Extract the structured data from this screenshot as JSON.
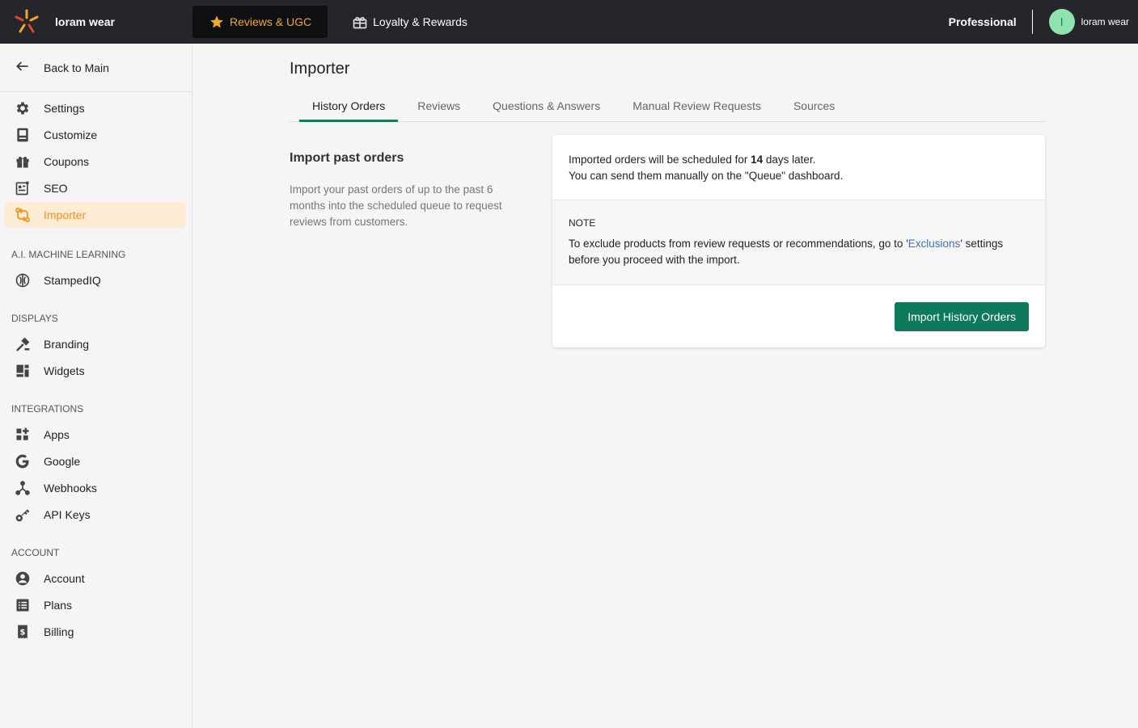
{
  "topbar": {
    "brand_name": "loram wear",
    "nav": [
      {
        "label": "Reviews & UGC",
        "icon": "star-icon",
        "active": true
      },
      {
        "label": "Loyalty & Rewards",
        "icon": "gift-icon",
        "active": false
      }
    ],
    "plan": "Professional",
    "avatar_initial": "l",
    "user_name": "loram wear"
  },
  "sidebar": {
    "back_label": "Back to Main",
    "items": [
      {
        "label": "Settings",
        "icon": "gear-icon"
      },
      {
        "label": "Customize",
        "icon": "customize-icon"
      },
      {
        "label": "Coupons",
        "icon": "gift-icon"
      },
      {
        "label": "SEO",
        "icon": "seo-icon"
      },
      {
        "label": "Importer",
        "icon": "importer-icon",
        "active": true
      }
    ],
    "sections": {
      "ai": {
        "label": "A.I. MACHINE LEARNING",
        "items": [
          {
            "label": "StampedIQ",
            "icon": "brain-icon"
          }
        ]
      },
      "displays": {
        "label": "DISPLAYS",
        "items": [
          {
            "label": "Branding",
            "icon": "hammer-icon"
          },
          {
            "label": "Widgets",
            "icon": "widgets-icon"
          }
        ]
      },
      "integrations": {
        "label": "INTEGRATIONS",
        "items": [
          {
            "label": "Apps",
            "icon": "apps-icon"
          },
          {
            "label": "Google",
            "icon": "google-icon"
          },
          {
            "label": "Webhooks",
            "icon": "webhooks-icon"
          },
          {
            "label": "API Keys",
            "icon": "key-icon"
          }
        ]
      },
      "account": {
        "label": "ACCOUNT",
        "items": [
          {
            "label": "Account",
            "icon": "user-icon"
          },
          {
            "label": "Plans",
            "icon": "list-icon"
          },
          {
            "label": "Billing",
            "icon": "billing-icon"
          }
        ]
      }
    }
  },
  "main": {
    "title": "Importer",
    "tabs": [
      "History Orders",
      "Reviews",
      "Questions & Answers",
      "Manual Review Requests",
      "Sources"
    ],
    "active_tab": 0,
    "section_title": "Import past orders",
    "section_desc": "Import your past orders of up to the past 6 months into the scheduled queue to request reviews from customers.",
    "card": {
      "line1_prefix": "Imported orders will be scheduled for ",
      "line1_days": "14",
      "line1_suffix": " days later.",
      "line2": "You can send them manually on the \"Queue\" dashboard.",
      "note_title": "NOTE",
      "note_prefix": "To exclude products from review requests or recommendations, go to '",
      "note_link": "Exclusions",
      "note_suffix": "' settings before you proceed with the import.",
      "button": "Import History Orders"
    }
  },
  "colors": {
    "topbar_bg": "#24262b",
    "accent_orange": "#f0901f",
    "primary_green": "#0e7a5b",
    "link_blue": "#3b6fb6"
  }
}
